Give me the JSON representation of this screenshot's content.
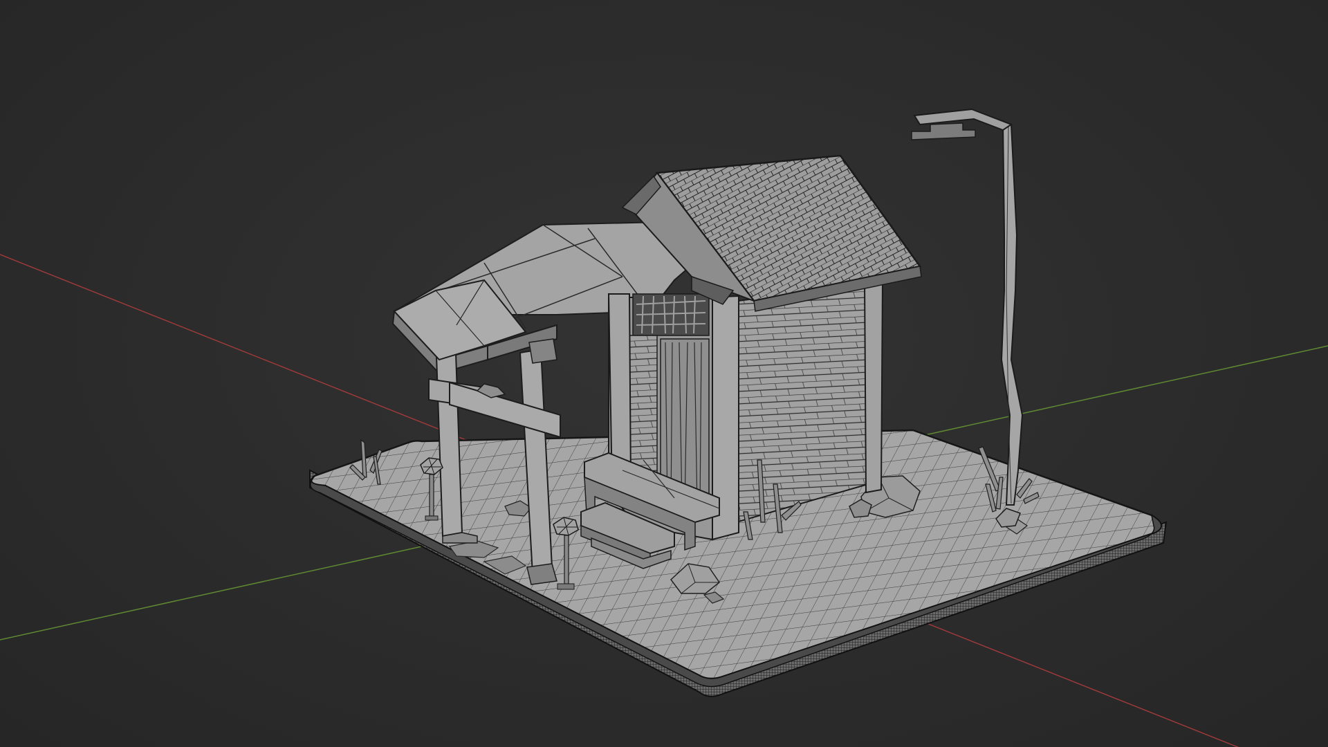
{
  "viewport": {
    "background": "#2c2c2c",
    "axis_x_color": "#9c3a3a",
    "axis_y_color": "#5f8a32",
    "object_fill": "#a9a9a9",
    "object_shade": "#7e7e7e",
    "object_dark": "#555555",
    "wire_color": "#1c1c1c"
  },
  "scene": {
    "objects": [
      "axis-x-line",
      "axis-y-line",
      "base-platform",
      "hut",
      "tiled-roof",
      "porch-roof",
      "porch-posts",
      "bench",
      "steps",
      "street-lamp",
      "lanterns",
      "rocks",
      "grass-tufts"
    ]
  }
}
